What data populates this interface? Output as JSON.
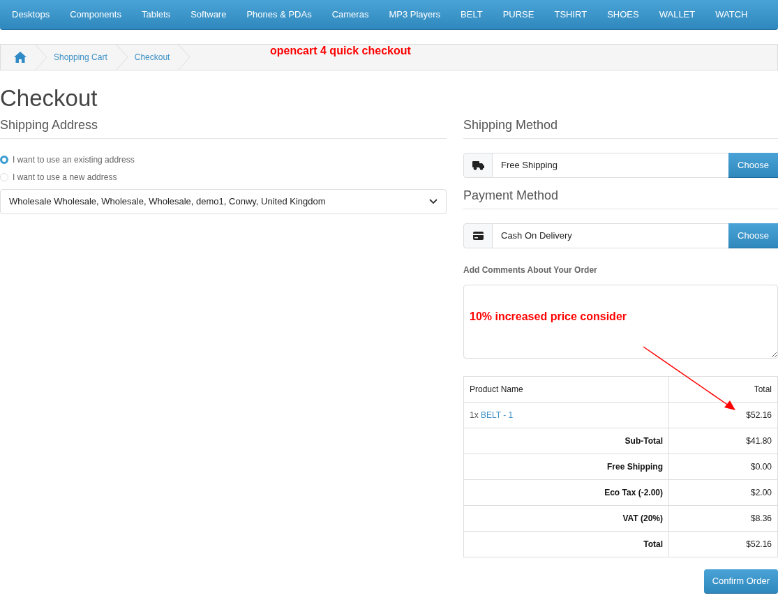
{
  "menu": [
    "Desktops",
    "Components",
    "Tablets",
    "Software",
    "Phones & PDAs",
    "Cameras",
    "MP3 Players",
    "BELT",
    "PURSE",
    "TSHIRT",
    "SHOES",
    "WALLET",
    "WATCH"
  ],
  "breadcrumb": [
    "Shopping Cart",
    "Checkout"
  ],
  "annotations": {
    "title": "opencart 4 quick checkout",
    "note": "10% increased price consider"
  },
  "page_title": "Checkout",
  "shipping_address": {
    "heading": "Shipping Address",
    "options": [
      {
        "label": "I want to use an existing address",
        "selected": true
      },
      {
        "label": "I want to use a new address",
        "selected": false
      }
    ],
    "address": "Wholesale Wholesale, Wholesale, Wholesale, demo1, Conwy, United Kingdom"
  },
  "shipping_method": {
    "heading": "Shipping Method",
    "value": "Free Shipping",
    "button": "Choose"
  },
  "payment_method": {
    "heading": "Payment Method",
    "value": "Cash On Delivery",
    "button": "Choose"
  },
  "comments": {
    "label": "Add Comments About Your Order"
  },
  "order": {
    "columns": [
      "Product Name",
      "Total"
    ],
    "products": [
      {
        "quantity": "1x",
        "name": "BELT - 1",
        "total": "$52.16"
      }
    ],
    "totals": [
      {
        "label": "Sub-Total",
        "value": "$41.80"
      },
      {
        "label": "Free Shipping",
        "value": "$0.00"
      },
      {
        "label": "Eco Tax (-2.00)",
        "value": "$2.00"
      },
      {
        "label": "VAT (20%)",
        "value": "$8.36"
      },
      {
        "label": "Total",
        "value": "$52.16"
      }
    ]
  },
  "confirm_button": "Confirm Order"
}
